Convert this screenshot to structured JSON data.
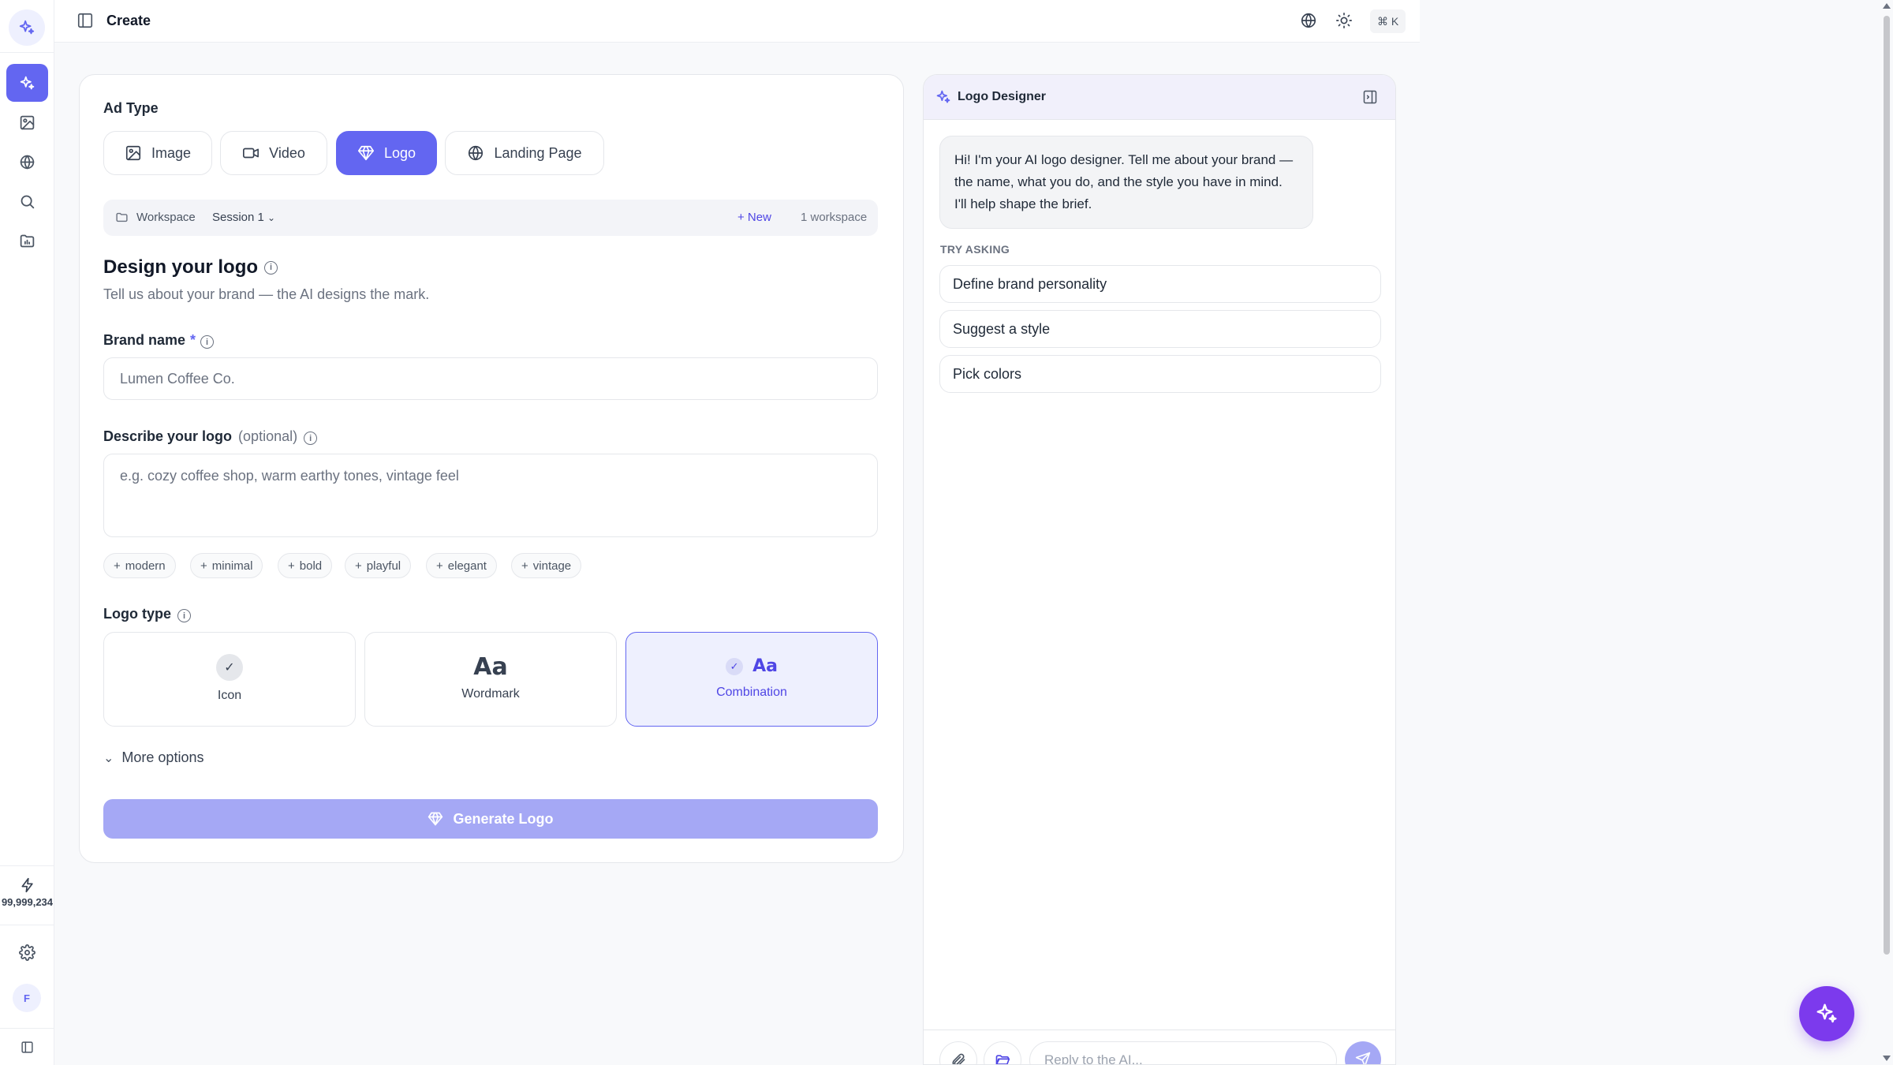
{
  "colors": {
    "accent": "#6366f1",
    "accent_light": "#eef0fe",
    "fab": "#7c3aed",
    "generate_disabled": "#a5a8f5"
  },
  "sidebar": {
    "items": [
      {
        "icon": "sparkles-icon",
        "active": true
      },
      {
        "icon": "image-icon"
      },
      {
        "icon": "globe-icon"
      },
      {
        "icon": "search-icon"
      },
      {
        "icon": "folder-chart-icon"
      }
    ],
    "credits": "99,999,234",
    "avatar_initial": "F"
  },
  "header": {
    "title": "Create",
    "shortcut": "⌘ K"
  },
  "form": {
    "ad_type_label": "Ad Type",
    "tabs": [
      {
        "label": "Image",
        "icon": "image-icon"
      },
      {
        "label": "Video",
        "icon": "video-icon"
      },
      {
        "label": "Logo",
        "icon": "diamond-icon",
        "active": true
      },
      {
        "label": "Landing Page",
        "icon": "globe-icon"
      }
    ],
    "workspace": {
      "label": "Workspace",
      "session": "Session 1",
      "new_label": "+ New",
      "count": "1 workspace"
    },
    "title": "Design your logo",
    "subtitle": "Tell us about your brand — the AI designs the mark.",
    "brand_name": {
      "label": "Brand name",
      "required_mark": "*",
      "placeholder": "Lumen Coffee Co."
    },
    "describe": {
      "label": "Describe your logo",
      "optional": "(optional)",
      "placeholder": "e.g. cozy coffee shop, warm earthy tones, vintage feel"
    },
    "chips": [
      "modern",
      "minimal",
      "bold",
      "playful",
      "elegant",
      "vintage"
    ],
    "logo_type": {
      "label": "Logo type",
      "options": [
        {
          "label": "Icon",
          "glyph": "✓"
        },
        {
          "label": "Wordmark",
          "glyph": "Aa"
        },
        {
          "label": "Combination",
          "glyph": "Aa",
          "selected": true
        }
      ]
    },
    "more_options": "More options",
    "generate_label": "Generate Logo"
  },
  "chat": {
    "title": "Logo Designer",
    "greeting": "Hi! I'm your AI logo designer. Tell me about your brand — the name, what you do, and the style you have in mind. I'll help shape the brief.",
    "try_label": "TRY ASKING",
    "suggestions": [
      "Define brand personality",
      "Suggest a style",
      "Pick colors"
    ],
    "reply_placeholder": "Reply to the AI..."
  }
}
